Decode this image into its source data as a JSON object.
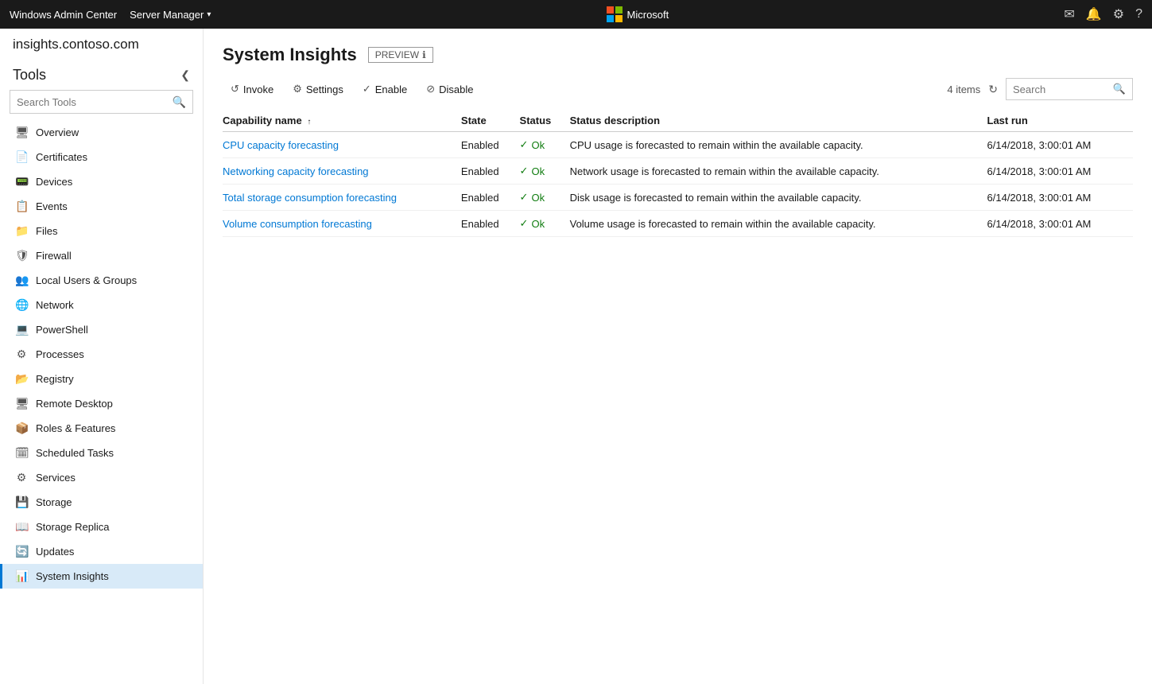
{
  "topbar": {
    "brand": "Windows Admin Center",
    "server": "Server Manager",
    "ms_label": "Microsoft",
    "icons": {
      "mail": "✉",
      "bell": "🔔",
      "gear": "⚙",
      "help": "?"
    }
  },
  "sidebar": {
    "server_name": "insights.contoso.com",
    "tools_label": "Tools",
    "collapse_label": "❮",
    "search_placeholder": "Search Tools",
    "nav_items": [
      {
        "id": "overview",
        "label": "Overview",
        "icon": "🖥"
      },
      {
        "id": "certificates",
        "label": "Certificates",
        "icon": "📄"
      },
      {
        "id": "devices",
        "label": "Devices",
        "icon": "📟"
      },
      {
        "id": "events",
        "label": "Events",
        "icon": "📋"
      },
      {
        "id": "files",
        "label": "Files",
        "icon": "📁"
      },
      {
        "id": "firewall",
        "label": "Firewall",
        "icon": "🛡"
      },
      {
        "id": "local-users",
        "label": "Local Users & Groups",
        "icon": "👥"
      },
      {
        "id": "network",
        "label": "Network",
        "icon": "🌐"
      },
      {
        "id": "powershell",
        "label": "PowerShell",
        "icon": "💻"
      },
      {
        "id": "processes",
        "label": "Processes",
        "icon": "⚙"
      },
      {
        "id": "registry",
        "label": "Registry",
        "icon": "📂"
      },
      {
        "id": "remote-desktop",
        "label": "Remote Desktop",
        "icon": "🖥"
      },
      {
        "id": "roles-features",
        "label": "Roles & Features",
        "icon": "📦"
      },
      {
        "id": "scheduled-tasks",
        "label": "Scheduled Tasks",
        "icon": "🗓"
      },
      {
        "id": "services",
        "label": "Services",
        "icon": "⚙"
      },
      {
        "id": "storage",
        "label": "Storage",
        "icon": "💾"
      },
      {
        "id": "storage-replica",
        "label": "Storage Replica",
        "icon": "📖"
      },
      {
        "id": "updates",
        "label": "Updates",
        "icon": "🔄"
      },
      {
        "id": "system-insights",
        "label": "System Insights",
        "icon": "📊",
        "active": true
      }
    ]
  },
  "content": {
    "page_title": "System Insights",
    "preview_badge": "PREVIEW",
    "preview_info_icon": "ℹ",
    "toolbar": {
      "invoke_label": "Invoke",
      "settings_label": "Settings",
      "enable_label": "Enable",
      "disable_label": "Disable",
      "item_count": "4 items",
      "search_placeholder": "Search"
    },
    "table": {
      "columns": [
        {
          "id": "capability",
          "label": "Capability name",
          "sortable": true
        },
        {
          "id": "state",
          "label": "State",
          "sortable": false
        },
        {
          "id": "status",
          "label": "Status",
          "sortable": false
        },
        {
          "id": "status_desc",
          "label": "Status description",
          "sortable": false
        },
        {
          "id": "last_run",
          "label": "Last run",
          "sortable": false
        }
      ],
      "rows": [
        {
          "capability": "CPU capacity forecasting",
          "state": "Enabled",
          "status": "Ok",
          "status_desc": "CPU usage is forecasted to remain within the available capacity.",
          "last_run": "6/14/2018, 3:00:01 AM"
        },
        {
          "capability": "Networking capacity forecasting",
          "state": "Enabled",
          "status": "Ok",
          "status_desc": "Network usage is forecasted to remain within the available capacity.",
          "last_run": "6/14/2018, 3:00:01 AM"
        },
        {
          "capability": "Total storage consumption forecasting",
          "state": "Enabled",
          "status": "Ok",
          "status_desc": "Disk usage is forecasted to remain within the available capacity.",
          "last_run": "6/14/2018, 3:00:01 AM"
        },
        {
          "capability": "Volume consumption forecasting",
          "state": "Enabled",
          "status": "Ok",
          "status_desc": "Volume usage is forecasted to remain within the available capacity.",
          "last_run": "6/14/2018, 3:00:01 AM"
        }
      ]
    }
  }
}
